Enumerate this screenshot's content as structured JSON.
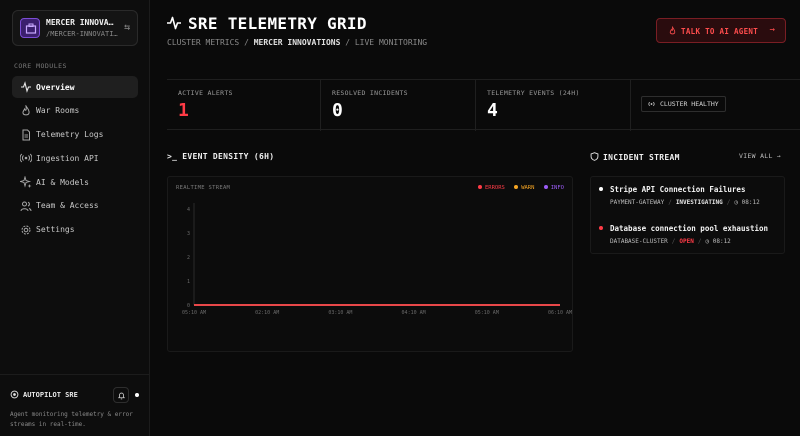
{
  "org": {
    "name": "MERCER INNOVA…",
    "slug": "/MERCER-INNOVATI…",
    "switch_icon": "swap-icon"
  },
  "sidebar": {
    "section_label": "CORE MODULES",
    "items": [
      {
        "label": "Overview",
        "icon": "activity-icon",
        "active": true
      },
      {
        "label": "War Rooms",
        "icon": "flame-icon"
      },
      {
        "label": "Telemetry Logs",
        "icon": "document-icon"
      },
      {
        "label": "Ingestion API",
        "icon": "radio-icon"
      },
      {
        "label": "AI & Models",
        "icon": "sparkle-icon"
      },
      {
        "label": "Team & Access",
        "icon": "users-icon"
      },
      {
        "label": "Settings",
        "icon": "gear-icon"
      }
    ]
  },
  "autopilot": {
    "title": "AUTOPILOT SRE",
    "description": "Agent monitoring telemetry & error streams in real-time."
  },
  "header": {
    "title": "SRE TELEMETRY GRID",
    "breadcrumb": {
      "part1": "CLUSTER METRICS",
      "sep": " / ",
      "part2": "MERCER INNOVATIONS",
      "part3": "LIVE MONITORING"
    },
    "ai_button": "TALK TO AI AGENT"
  },
  "stats": {
    "active_alerts": {
      "label": "ACTIVE ALERTS",
      "value": "1"
    },
    "resolved": {
      "label": "RESOLVED INCIDENTS",
      "value": "0"
    },
    "events": {
      "label": "TELEMETRY EVENTS (24H)",
      "value": "4"
    },
    "health": "CLUSTER HEALTHY"
  },
  "density": {
    "heading": "EVENT DENSITY (6H)",
    "stream_label": "REALTIME STREAM",
    "legend": {
      "errors": "ERRORS",
      "warn": "WARN",
      "info": "INFO"
    }
  },
  "incident_stream": {
    "heading": "INCIDENT STREAM",
    "view_all": "VIEW ALL →",
    "items": [
      {
        "title": "Stripe API Connection Failures",
        "service": "PAYMENT-GATEWAY",
        "status": "INVESTIGATING",
        "time": "08:12"
      },
      {
        "title": "Database connection pool exhaustion",
        "service": "DATABASE-CLUSTER",
        "status": "OPEN",
        "time": "08:12"
      }
    ]
  },
  "colors": {
    "accent_red": "#ff3b46",
    "warn": "#f5a524",
    "info": "#9b5cf6",
    "bg": "#0a0a0a"
  },
  "chart_data": {
    "type": "line",
    "x": [
      "05:10 AM",
      "02:10 AM",
      "03:10 AM",
      "04:10 AM",
      "05:10 AM",
      "06:10 AM"
    ],
    "series": [
      {
        "name": "ERRORS",
        "values": [
          0,
          0,
          0,
          0,
          0,
          0
        ]
      },
      {
        "name": "WARN",
        "values": [
          0,
          0,
          0,
          0,
          0,
          0
        ]
      },
      {
        "name": "INFO",
        "values": [
          0,
          0,
          0,
          0,
          0,
          0
        ]
      }
    ],
    "ylim": [
      0,
      4
    ],
    "yticks": [
      0,
      1,
      2,
      3,
      4
    ],
    "grid": false,
    "legend": "top-right"
  }
}
